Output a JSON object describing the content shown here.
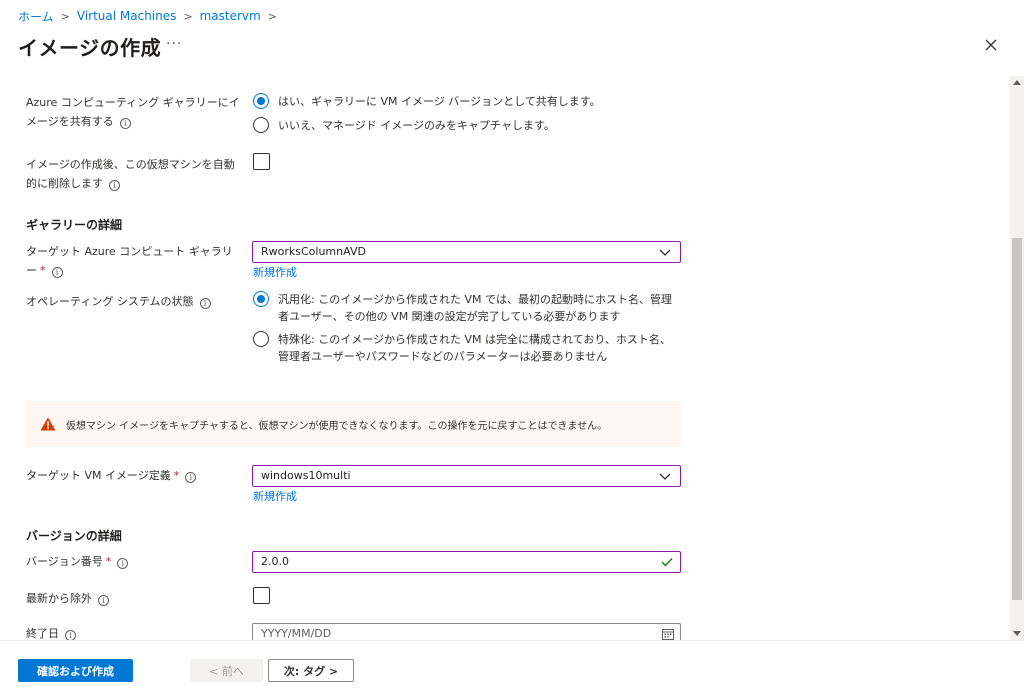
{
  "breadcrumb": {
    "items": [
      "ホーム",
      "Virtual Machines",
      "mastervm"
    ],
    "separator": ">"
  },
  "header": {
    "title": "イメージの作成",
    "more": "···"
  },
  "form": {
    "share_gallery": {
      "label": "Azure コンピューティング ギャラリーにイメージを共有する",
      "info": "i",
      "options": [
        {
          "text": "はい、ギャラリーに VM イメージ バージョンとして共有します。",
          "checked": true
        },
        {
          "text": "いいえ、マネージド イメージのみをキャプチャします。",
          "checked": false
        }
      ]
    },
    "auto_delete": {
      "label": "イメージの作成後、この仮想マシンを自動的に削除します",
      "info": "i",
      "checked": false
    },
    "gallery_section": {
      "title": "ギャラリーの詳細"
    },
    "target_gallery": {
      "label": "ターゲット Azure コンピュート ギャラリー",
      "required": "*",
      "info": "i",
      "value": "RworksColumnAVD",
      "new_link": "新規作成"
    },
    "os_state": {
      "label": "オペレーティング システムの状態",
      "info": "i",
      "options": [
        {
          "text": "汎用化: このイメージから作成された VM では、最初の起動時にホスト名、管理者ユーザー、その他の VM 関連の設定が完了している必要があります",
          "checked": true
        },
        {
          "text": "特殊化: このイメージから作成された VM は完全に構成されており、ホスト名、管理者ユーザーやパスワードなどのパラメーターは必要ありません",
          "checked": false
        }
      ]
    },
    "warning": {
      "text": "仮想マシン イメージをキャプチャすると、仮想マシンが使用できなくなります。この操作を元に戻すことはできません。",
      "color": "#d83b01"
    },
    "target_definition": {
      "label": "ターゲット VM イメージ定義",
      "required": "*",
      "info": "i",
      "value": "windows10multi",
      "new_link": "新規作成"
    },
    "version_section": {
      "title": "バージョンの詳細"
    },
    "version_number": {
      "label": "バージョン番号",
      "required": "*",
      "info": "i",
      "value": "2.0.0",
      "valid_color": "#107c10"
    },
    "exclude_latest": {
      "label": "最新から除外",
      "info": "i",
      "checked": false
    },
    "end_date": {
      "label": "終了日",
      "info": "i",
      "placeholder": "YYYY/MM/DD"
    }
  },
  "footer": {
    "review_create": "確認および作成",
    "previous": "< 前へ",
    "next": "次: タグ >"
  },
  "colors": {
    "accent": "#0078d4",
    "focus_border": "#8a1ca3",
    "warning_bg": "#fdf6f1"
  }
}
